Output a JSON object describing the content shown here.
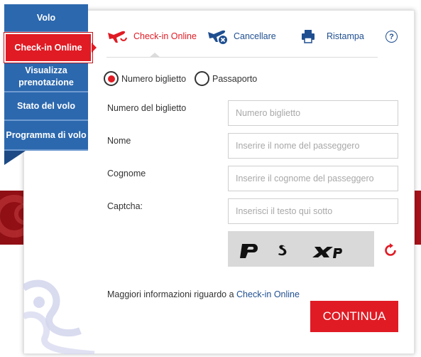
{
  "sidebar": {
    "items": [
      {
        "label": "Volo"
      },
      {
        "label": "Check-in Online"
      },
      {
        "label": "Visualizza prenotazione"
      },
      {
        "label": "Stato del volo"
      },
      {
        "label": "Programma di volo"
      }
    ],
    "active_index": 1
  },
  "tabs": [
    {
      "label": "Check-in Online",
      "icon": "plane-checkin-icon",
      "active": true
    },
    {
      "label": "Cancellare",
      "icon": "plane-cancel-icon",
      "active": false
    },
    {
      "label": "Ristampa",
      "icon": "printer-icon",
      "active": false
    }
  ],
  "help": {
    "glyph": "?"
  },
  "radios": [
    {
      "label": "Numero biglietto",
      "checked": true
    },
    {
      "label": "Passaporto",
      "checked": false
    }
  ],
  "form": {
    "ticket": {
      "label": "Numero del biglietto",
      "placeholder": "Numero biglietto",
      "value": ""
    },
    "first_name": {
      "label": "Nome",
      "placeholder": "Inserire il nome del passeggero",
      "value": ""
    },
    "last_name": {
      "label": "Cognome",
      "placeholder": "Inserire il cognome del passeggero",
      "value": ""
    },
    "captcha": {
      "label": "Captcha:",
      "placeholder": "Inserisci il testo qui sotto",
      "value": ""
    }
  },
  "captcha_image": {
    "text": "p s xp"
  },
  "more_info": {
    "prefix": "Maggiori informazioni riguardo a ",
    "link": "Check-in Online"
  },
  "continue_label": "CONTINUA",
  "colors": {
    "brand_red": "#e01b24",
    "brand_blue": "#2c68ae",
    "link_blue": "#1f4f91"
  }
}
